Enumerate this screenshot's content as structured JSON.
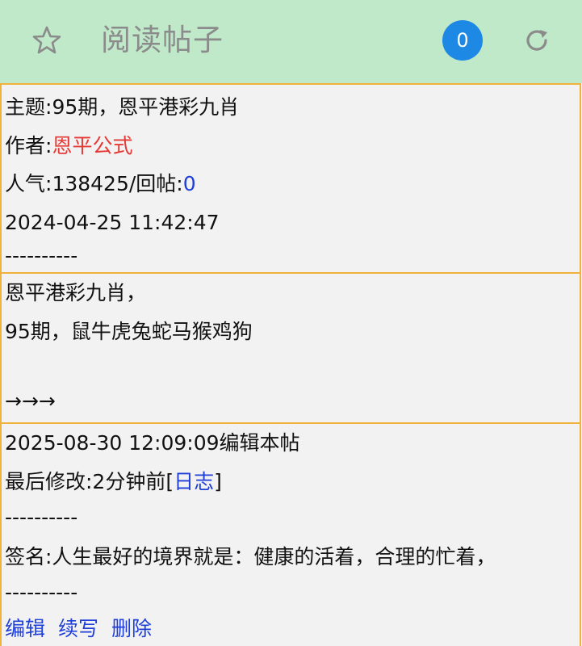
{
  "header": {
    "title": "阅读帖子",
    "badge_count": "0",
    "star_icon": "star-icon",
    "refresh_icon": "refresh-icon",
    "background_color": "#bfe9c9",
    "badge_color": "#1e88e5"
  },
  "post_info": {
    "subject_label": "主题:",
    "subject": "95期，恩平港彩九肖",
    "author_label": "作者:",
    "author": "恩平公式",
    "popularity_label": "人气:",
    "popularity": "138425",
    "replies_label": "/回帖:",
    "replies": "0",
    "datetime": "2024-04-25 11:42:47",
    "divider": "----------"
  },
  "post_body": {
    "line1": "恩平港彩九肖，",
    "line2": "95期，鼠牛虎兔蛇马猴鸡狗",
    "arrows": "→→→"
  },
  "post_footer": {
    "edit_info": "2025-08-30 12:09:09编辑本帖",
    "last_modified_label": "最后修改:2分钟前",
    "bracket_open": "[",
    "log_link": "日志",
    "bracket_close": "]",
    "divider1": "----------",
    "signature": "签名:人生最好的境界就是：健康的活着，合理的忙着，",
    "divider2": "----------",
    "actions": {
      "edit": "编辑",
      "continue": "续写",
      "delete": "删除"
    }
  }
}
